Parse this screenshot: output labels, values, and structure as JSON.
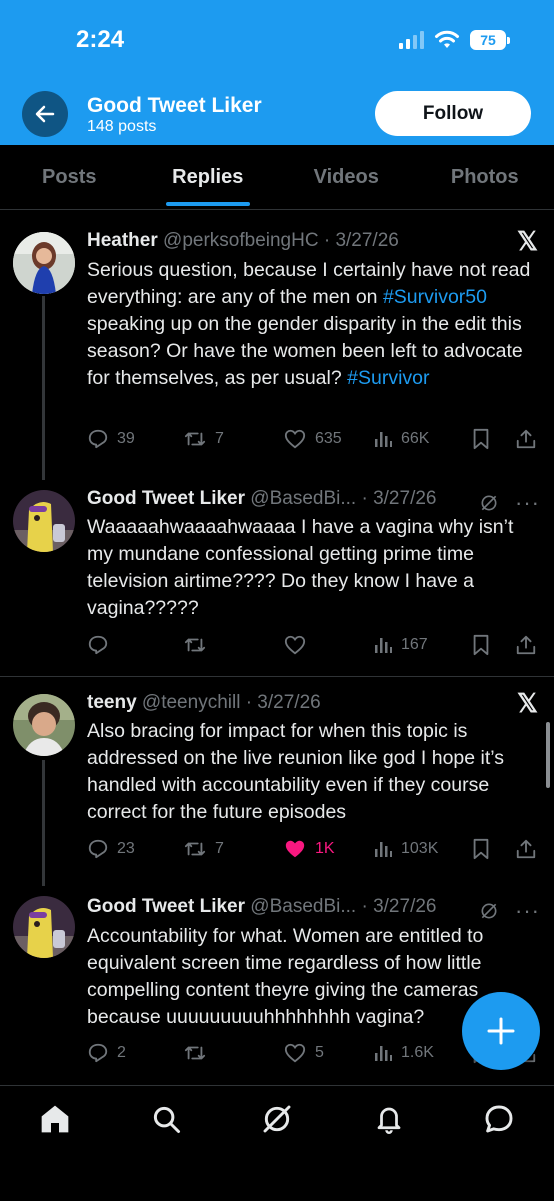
{
  "status_bar": {
    "time": "2:24",
    "battery": "75"
  },
  "header": {
    "name": "Good Tweet Liker",
    "post_count": "148 posts",
    "follow_label": "Follow"
  },
  "tabs": [
    {
      "label": "Posts",
      "active": false
    },
    {
      "label": "Replies",
      "active": true
    },
    {
      "label": "Videos",
      "active": false
    },
    {
      "label": "Photos",
      "active": false
    }
  ],
  "tweets": [
    {
      "name": "Heather",
      "handle": "@perksofbeingHC",
      "date": "· 3/27/26",
      "text_parts": [
        "Serious question, because I certainly have not read everything: are any of the men on ",
        "#Survivor50",
        " speaking up on the gender disparity in the edit this season? Or have the women been left to advocate for themselves, as per usual? ",
        "#Survivor"
      ],
      "replies": "39",
      "reposts": "7",
      "likes": "635",
      "views": "66K"
    },
    {
      "name": "Good Tweet Liker",
      "handle": "@BasedBi...",
      "date": "· 3/27/26",
      "text": "Waaaaahwaaaahwaaaa I have a vagina why isn’t my mundane confessional getting prime time television airtime???? Do they know I have a vagina?????",
      "replies": "",
      "reposts": "",
      "likes": "",
      "views": "167"
    },
    {
      "name": "teeny",
      "handle": "@teenychill",
      "date": "· 3/27/26",
      "text": "Also bracing for impact for when this topic is addressed on the live reunion like god I hope it’s handled with accountability even if they course correct for the future episodes",
      "replies": "23",
      "reposts": "7",
      "likes": "1K",
      "views": "103K"
    },
    {
      "name": "Good Tweet Liker",
      "handle": "@BasedBi...",
      "date": "· 3/27/26",
      "text": "Accountability for what. Women are entitled to equivalent screen time regardless of how little compelling content theyre giving the cameras because uuuuuuuuuhhhhhhhh vagina?",
      "replies": "2",
      "reposts": "",
      "likes": "5",
      "views": "1.6K"
    }
  ],
  "colors": {
    "accent": "#1d9bf0",
    "like": "#f91880",
    "muted": "#71767b",
    "background": "#000000"
  },
  "bottom_nav": [
    "home-icon",
    "search-icon",
    "grok-icon",
    "notifications-icon",
    "messages-icon"
  ]
}
